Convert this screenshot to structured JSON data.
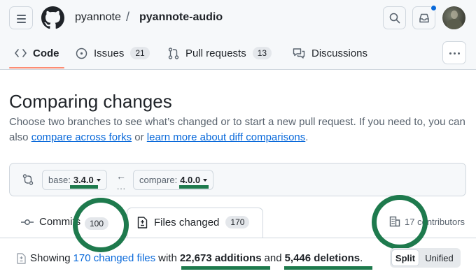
{
  "header": {
    "owner": "pyannote",
    "separator": "/",
    "repo": "pyannote-audio",
    "icons": [
      "hamburger-menu-icon",
      "github-logo-icon",
      "search-icon",
      "inbox-icon",
      "avatar"
    ]
  },
  "nav": {
    "tabs": [
      {
        "label": "Code",
        "icon": "code-icon",
        "active": true
      },
      {
        "label": "Issues",
        "icon": "issue-icon",
        "count": "21"
      },
      {
        "label": "Pull requests",
        "icon": "pull-request-icon",
        "count": "13"
      },
      {
        "label": "Discussions",
        "icon": "discussions-icon"
      }
    ]
  },
  "page": {
    "title": "Comparing changes",
    "desc_prefix": "Choose two branches to see what’s changed or to start a new pull request. If you need to, you can also ",
    "link_forks": "compare across forks",
    "desc_or": " or ",
    "link_learn": "learn more about diff comparisons",
    "desc_end": "."
  },
  "compare": {
    "base_label": "base:",
    "base_value": "3.4.0",
    "compare_label": "compare:",
    "compare_value": "4.0.0",
    "arrow": "←",
    "dots": "..."
  },
  "commit_tabs": {
    "commits_label": "Commits",
    "commits_count": "100",
    "files_label": "Files changed",
    "files_count": "170",
    "contributors_count": "17",
    "contributors_label": "contributors"
  },
  "summary": {
    "prefix": "Showing",
    "files_link": "170 changed files",
    "with": "with",
    "additions": "22,673 additions",
    "and": "and",
    "deletions": "5,446 deletions",
    "end": "."
  },
  "view_toggle": {
    "split": "Split",
    "unified": "Unified",
    "selected": "Split"
  },
  "colors": {
    "accent": "#0969da",
    "highlight": "#1e7a4d",
    "tab_underline": "#fd8c73"
  }
}
